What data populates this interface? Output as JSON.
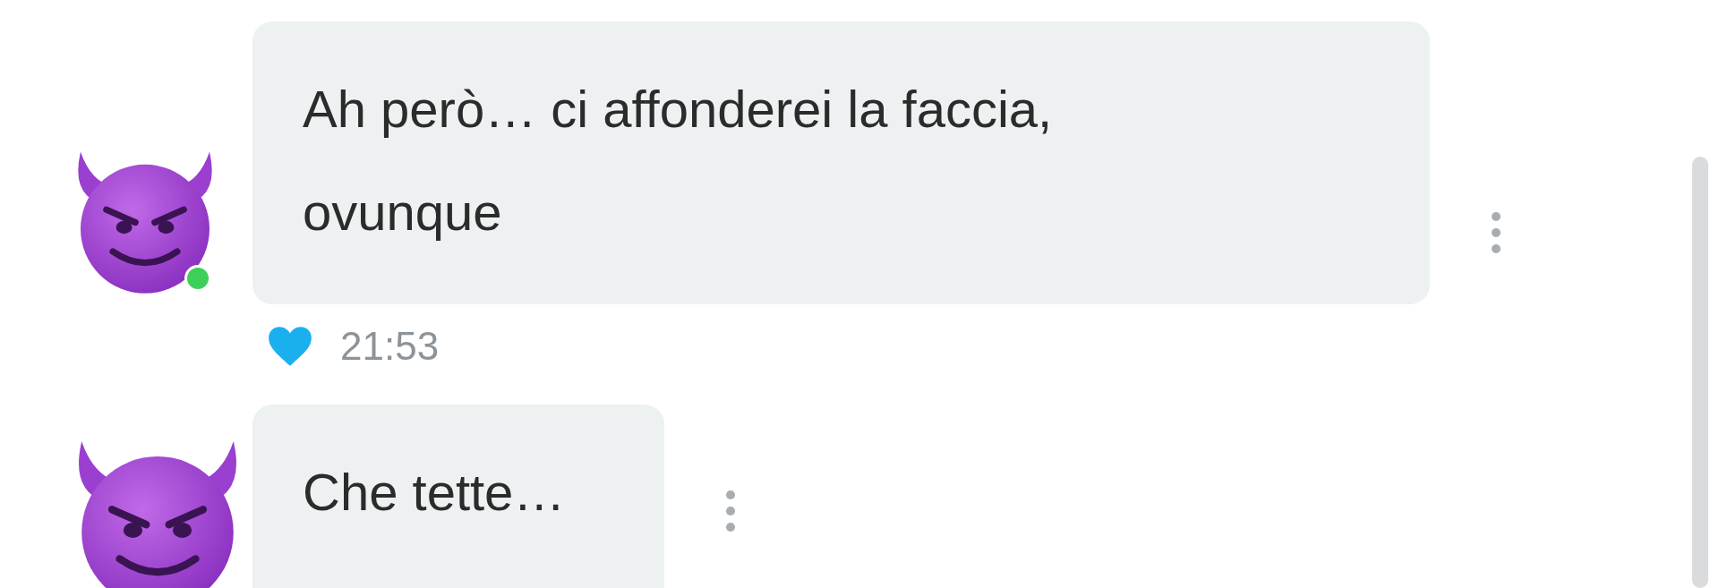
{
  "messages": [
    {
      "text": "Ah però… ci affonderei la faccia, ovunque",
      "online": true,
      "meta": {
        "liked": true,
        "time": "21:53"
      }
    },
    {
      "text": "Che tette…"
    }
  ]
}
